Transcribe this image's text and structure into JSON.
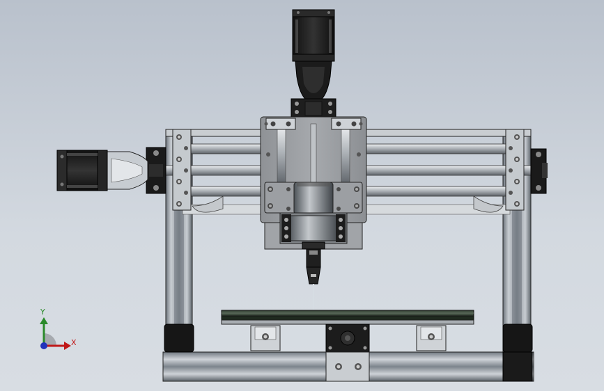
{
  "view": {
    "background_top": "#b9c1cc",
    "background_bottom": "#d8dde3"
  },
  "triad": {
    "x_label": "X",
    "y_label": "Y",
    "x_color": "#c01818",
    "y_color": "#2a8a2a",
    "z_color": "#2233bb"
  },
  "model": {
    "frame_color": "#9aa2ab",
    "rod_color": "#c8ccd0",
    "carriage_color": "#9a9da1",
    "motor_color": "#1c1c1c",
    "bed_color": "#3a4a3a"
  }
}
